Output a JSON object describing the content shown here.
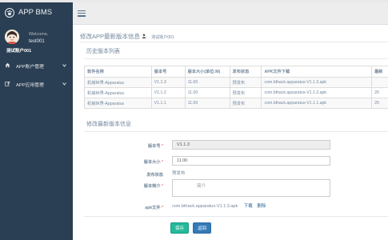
{
  "app": {
    "title": "APP BMS"
  },
  "profile": {
    "welcome": "Welcome,",
    "username": "test001",
    "role": "测试账户001"
  },
  "sidebar": {
    "items": [
      {
        "label": "APP账户管理",
        "icon": "home-icon"
      },
      {
        "label": "APP应用管理",
        "icon": "edit-icon"
      }
    ]
  },
  "page": {
    "title": "修改APP最新版本信息",
    "user_suffix": "测试账户001",
    "history_heading": "历史版本列表",
    "edit_heading": "修改最新版本信息"
  },
  "history": {
    "columns": [
      "软件名称",
      "版本号",
      "版本大小(单位:M)",
      "发布状态",
      "APK文件下载",
      "最新"
    ],
    "rows": [
      [
        "机械世界-Apparatus",
        "V1.1.3",
        "11.00",
        "预发布",
        "com.bthack.apparatus-V1.1.3.apk",
        ""
      ],
      [
        "机械世界-Apparatus",
        "V1.1.2",
        "11.00",
        "预发布",
        "com.bthack.apparatus-V1.1.2.apk",
        "20"
      ],
      [
        "机械世界-Apparatus",
        "V1.1.1",
        "11.00",
        "预发布",
        "com.bthack.apparatus-V1.1.1.apk",
        "20"
      ]
    ]
  },
  "form": {
    "version_label": "版本号",
    "version_value": "V1.1.3",
    "size_label": "版本大小",
    "size_value": "11.00",
    "status_label": "发布状态",
    "status_value": "预发布",
    "desc_label": "版本简介",
    "desc_value": "简介",
    "apk_label": "apk文件",
    "apk_value": "com.bthack.apparatus-V1.1.3.apk",
    "download_label": "下载",
    "delete_label": "删除",
    "required_mark": "*"
  },
  "buttons": {
    "save": "保存",
    "back": "返回"
  },
  "colors": {
    "sidebar": "#2a3f54",
    "save": "#26b99a",
    "back": "#337ab7",
    "navbar": "#ededed"
  }
}
